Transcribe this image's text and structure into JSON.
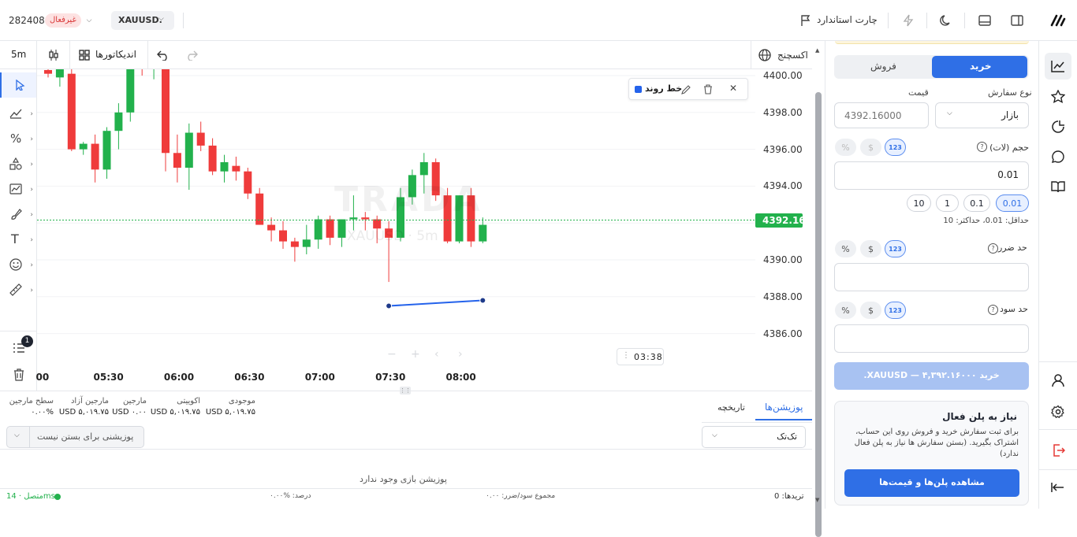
{
  "account": {
    "number": "282408",
    "status": "غیرفعال"
  },
  "symbol": "XAUUSD.",
  "header": {
    "standard_chart": "چارت استاندارد"
  },
  "chart_toolbar": {
    "timeframe": "5m",
    "indicators": "اندیکاتورها",
    "exchange": "اکسچنج"
  },
  "drawing_badge": {
    "label": "خط روند",
    "color": "#2563eb"
  },
  "watermark": {
    "logo": "TRADA",
    "symbol": "XAUUSD · 5m"
  },
  "timer": "03:38",
  "price_line": {
    "label": "4392.16",
    "color": "#22b14c"
  },
  "left_tools": {
    "alerts_count": "1"
  },
  "chart_data": {
    "type": "candlestick",
    "x": [
      "05:30",
      "06:00",
      "06:30",
      "07:00",
      "07:30",
      "08:00"
    ],
    "y_ticks": [
      "4400.00",
      "4398.00",
      "4396.00",
      "4394.00",
      "4392.00",
      "4390.00",
      "4388.00",
      "4386.00"
    ],
    "x_tick_edge": "00",
    "ylim": [
      4385.3,
      4400.4
    ],
    "up_color": "#22b14c",
    "down_color": "#ef3b3b",
    "candles": [
      [
        4400.3,
        4400.6,
        4399.9,
        4400.1
      ],
      [
        4399.9,
        4400.6,
        4399.4,
        4400.4
      ],
      [
        4400.1,
        4400.6,
        4395.9,
        4396.0
      ],
      [
        4396.0,
        4396.4,
        4395.7,
        4396.3
      ],
      [
        4396.3,
        4396.8,
        4394.2,
        4394.9
      ],
      [
        4394.9,
        4397.2,
        4394.4,
        4397.0
      ],
      [
        4397.0,
        4398.5,
        4396.0,
        4398.0
      ],
      [
        4398.0,
        4401.5,
        4397.5,
        4401.0
      ],
      [
        4401.0,
        4401.5,
        4400.0,
        4400.5
      ],
      [
        4400.5,
        4401.8,
        4399.8,
        4400.9
      ],
      [
        4400.7,
        4401.0,
        4394.8,
        4395.8
      ],
      [
        4395.8,
        4396.8,
        4394.2,
        4395.0
      ],
      [
        4395.0,
        4397.4,
        4393.8,
        4396.9
      ],
      [
        4396.9,
        4397.5,
        4395.9,
        4396.2
      ],
      [
        4396.2,
        4396.6,
        4394.6,
        4394.8
      ],
      [
        4394.8,
        4395.7,
        4394.2,
        4395.3
      ],
      [
        4395.1,
        4395.6,
        4394.3,
        4394.8
      ],
      [
        4394.8,
        4395.0,
        4393.3,
        4393.6
      ],
      [
        4393.6,
        4393.9,
        4391.9,
        4391.9
      ],
      [
        4391.9,
        4392.3,
        4391.0,
        4391.6
      ],
      [
        4391.6,
        4392.1,
        4390.6,
        4391.0
      ],
      [
        4391.0,
        4391.2,
        4389.9,
        4390.7
      ],
      [
        4390.7,
        4391.9,
        4390.3,
        4391.1
      ],
      [
        4391.1,
        4392.4,
        4390.6,
        4392.2
      ],
      [
        4392.2,
        4392.4,
        4390.8,
        4391.2
      ],
      [
        4391.2,
        4392.2,
        4390.7,
        4392.2
      ],
      [
        4392.2,
        4393.5,
        4391.6,
        4392.3
      ],
      [
        4392.3,
        4392.6,
        4391.6,
        4392.2
      ],
      [
        4392.2,
        4392.4,
        4390.9,
        4391.7
      ],
      [
        4391.7,
        4392.1,
        4388.8,
        4391.2
      ],
      [
        4391.2,
        4393.9,
        4391.0,
        4393.4
      ],
      [
        4393.4,
        4394.9,
        4393.0,
        4394.6
      ],
      [
        4394.6,
        4395.8,
        4393.6,
        4395.3
      ],
      [
        4395.3,
        4395.5,
        4393.2,
        4393.5
      ],
      [
        4393.5,
        4393.9,
        4390.9,
        4391.0
      ],
      [
        4391.0,
        4393.1,
        4390.9,
        4393.5
      ],
      [
        4393.5,
        4393.9,
        4390.7,
        4391.0
      ],
      [
        4391.0,
        4392.3,
        4390.9,
        4391.9
      ]
    ],
    "trend_line": [
      [
        29,
        4387.5
      ],
      [
        37,
        4387.8
      ]
    ]
  },
  "order_panel": {
    "buy_tab": "خرید",
    "sell_tab": "فروش",
    "order_type_label": "نوع سفارش",
    "order_type_value": "بازار",
    "price_label": "قیمت",
    "price_placeholder": "4392.16000",
    "volume_label": "حجم (لات)",
    "volume_value": "0.01",
    "quick_volumes": [
      "0.01",
      "0.1",
      "1",
      "10"
    ],
    "volume_limits": "حداقل: 0.01، حداکثر: 10",
    "stop_loss_label": "حد ضرر",
    "take_profit_label": "حد سود",
    "mode_numeric": "123",
    "mode_dollar": "$",
    "mode_percent": "%",
    "submit": "خرید  ۴,۳۹۲.۱۶۰۰۰  —  XAUUSD.",
    "plan_title": "نیاز به پلن فعال",
    "plan_text": "برای ثبت سفارش خرید و فروش روی این حساب، اشتراک بگیرید. (بستن سفارش ها نیاز به پلن فعال ندارد)",
    "plan_button": "مشاهده پلن‌ها و قیمت‌ها"
  },
  "bottom": {
    "tab_positions": "پوزیشن‌ها",
    "tab_history": "تاریخچه",
    "stats": [
      {
        "label": "موجودی",
        "value": "USD ۵,۰۱۹.۷۵"
      },
      {
        "label": "اکوییتی",
        "value": "USD ۵,۰۱۹.۷۵"
      },
      {
        "label": "مارجین",
        "value": "USD ۰.۰۰"
      },
      {
        "label": "مارجین آزاد",
        "value": "USD ۵,۰۱۹.۷۵"
      },
      {
        "label": "سطح مارجین",
        "value": "۰.۰۰%"
      }
    ],
    "filter_value": "تک‌تک",
    "close_all": "پوزیشنی برای بستن نیست",
    "empty": "پوزیشن بازی وجود ندارد"
  },
  "status_bar": {
    "trades": "تریدها: 0",
    "total_pnl": "مجموع سود/ضرر: ۰.۰۰",
    "percent": "درصد: %۰.۰۰",
    "connection": "متصل · 14ms"
  }
}
